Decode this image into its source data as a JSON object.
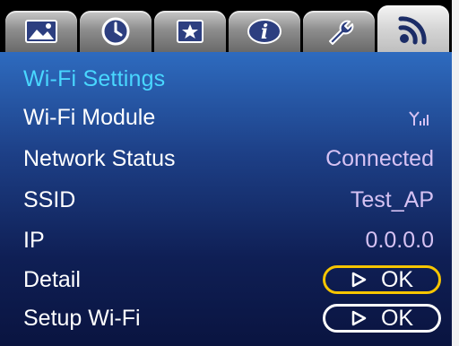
{
  "tabs": [
    {
      "icon": "picture-icon"
    },
    {
      "icon": "clock-icon"
    },
    {
      "icon": "star-frame-icon"
    },
    {
      "icon": "info-icon"
    },
    {
      "icon": "wrench-icon"
    },
    {
      "icon": "wifi-icon",
      "active": true
    }
  ],
  "page": {
    "title": "Wi-Fi Settings"
  },
  "rows": {
    "module": {
      "label": "Wi-Fi Module",
      "signal_icon": "signal-bars-icon"
    },
    "network_status": {
      "label": "Network Status",
      "value": "Connected"
    },
    "ssid": {
      "label": "SSID",
      "value": "Test_AP"
    },
    "ip": {
      "label": "IP",
      "value": "0.0.0.0"
    },
    "detail": {
      "label": "Detail",
      "button_label": "OK"
    },
    "setup": {
      "label": "Setup Wi-Fi",
      "button_label": "OK"
    }
  },
  "colors": {
    "title": "#49d7ff",
    "value": "#d6c2f3",
    "focus_border": "#f7c500",
    "button_border": "#ffffff",
    "background_top": "#2e6bbf",
    "background_bottom": "#0a1440"
  }
}
